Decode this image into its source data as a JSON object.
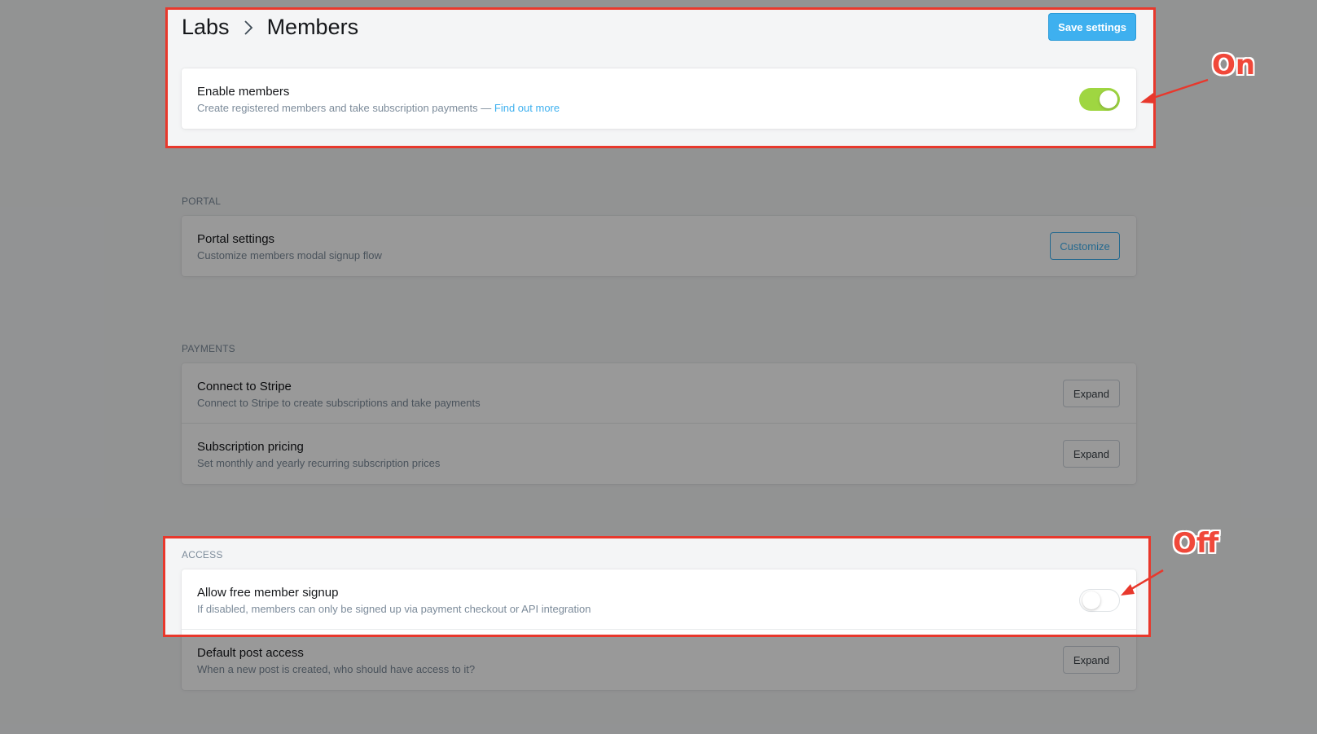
{
  "breadcrumb": {
    "parent": "Labs",
    "current": "Members"
  },
  "toolbar": {
    "save_label": "Save settings"
  },
  "enable_members": {
    "title": "Enable members",
    "description": "Create registered members and take subscription payments —",
    "link": "Find out more",
    "toggle_state": "on"
  },
  "portal": {
    "section_label": "PORTAL",
    "title": "Portal settings",
    "description": "Customize members modal signup flow",
    "button": "Customize"
  },
  "payments": {
    "section_label": "PAYMENTS",
    "items": [
      {
        "title": "Connect to Stripe",
        "description": "Connect to Stripe to create subscriptions and take payments",
        "button": "Expand"
      },
      {
        "title": "Subscription pricing",
        "description": "Set monthly and yearly recurring subscription prices",
        "button": "Expand"
      }
    ]
  },
  "access": {
    "section_label": "ACCESS",
    "free_signup": {
      "title": "Allow free member signup",
      "description": "If disabled, members can only be signed up via payment checkout or API integration",
      "toggle_state": "off"
    },
    "default_post": {
      "title": "Default post access",
      "description": "When a new post is created, who should have access to it?",
      "button": "Expand"
    }
  },
  "annotations": {
    "on": "On",
    "off": "Off"
  },
  "colors": {
    "accent": "#3eb0ef",
    "toggle_on": "#9fd641",
    "highlight": "#e8382c"
  }
}
